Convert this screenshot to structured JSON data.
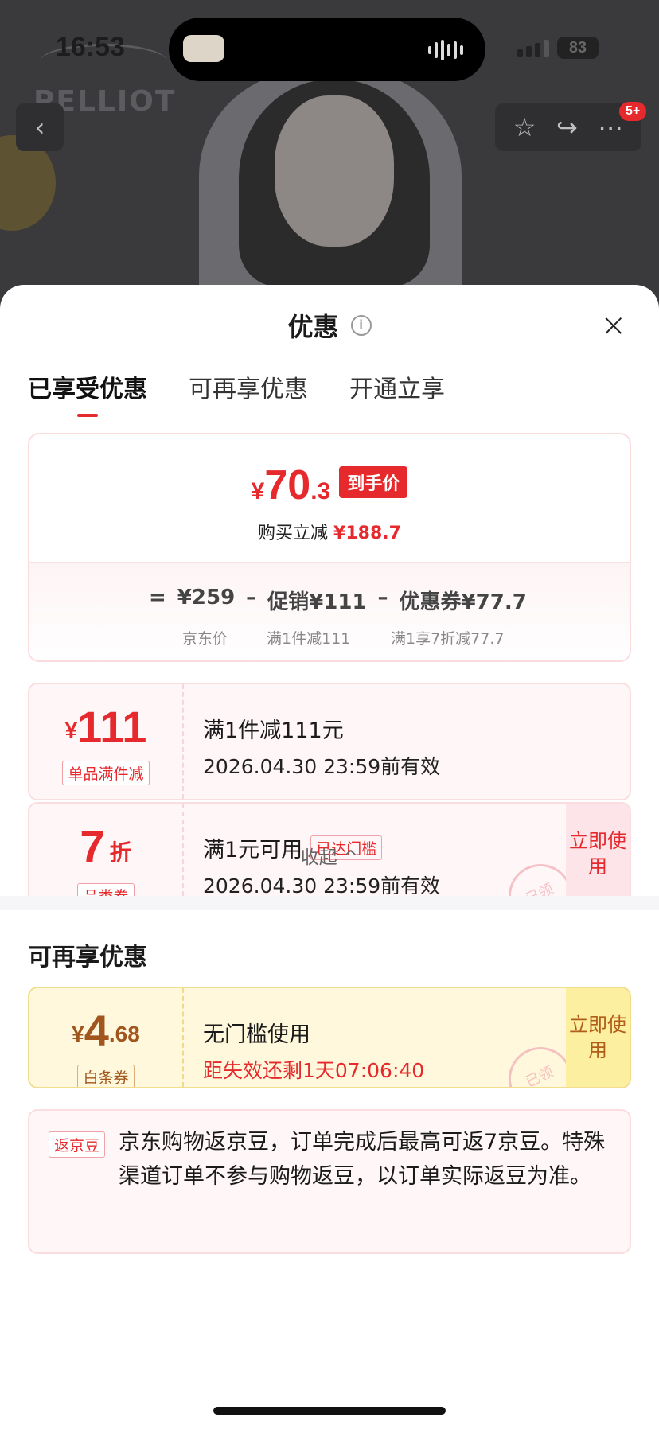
{
  "status_bar": {
    "time": "16:53",
    "battery": "83"
  },
  "hero": {
    "brand_logo": "PELLIOT",
    "badge": "5+"
  },
  "sheet": {
    "title": "优惠",
    "tabs": [
      "已享受优惠",
      "可再享优惠",
      "开通立享"
    ],
    "price": {
      "currency": "¥",
      "amount_main": "70",
      "amount_decimal": ".3",
      "tag": "到手价",
      "reduce_label": "购买立减",
      "reduce_value": "¥188.7",
      "formula": [
        "=",
        "¥259",
        "–",
        "促销¥111",
        "–",
        "优惠券¥77.7"
      ],
      "sublabels": [
        "京东价",
        "满1件减111",
        "满1享7折减77.7"
      ]
    },
    "coupons": [
      {
        "currency": "¥",
        "amount": "111",
        "suffix": "",
        "label": "单品满件减",
        "title": "满1件减111元",
        "chip": "",
        "subtitle": "2026.04.30 23:59前有效",
        "use": "",
        "stamp": ""
      },
      {
        "currency": "",
        "amount": "7",
        "suffix": "折",
        "label": "品类券",
        "title": "满1元可用",
        "chip": "已达门槛",
        "subtitle": "2026.04.30 23:59前有效",
        "use": "立即使用",
        "stamp": "已领"
      }
    ],
    "collapse": "收起 ^",
    "more_title": "可再享优惠",
    "more_coupon": {
      "currency": "¥",
      "amount": "4",
      "decimal": ".68",
      "label": "白条券",
      "title": "无门槛使用",
      "subtitle": "距失效还剩1天07:06:40",
      "use": "立即使用",
      "stamp": "已领"
    },
    "bean": {
      "tag": "返京豆",
      "text": "京东购物返京豆，订单完成后最高可返7京豆。特殊渠道订单不参与购物返豆，以订单实际返豆为准。"
    }
  }
}
